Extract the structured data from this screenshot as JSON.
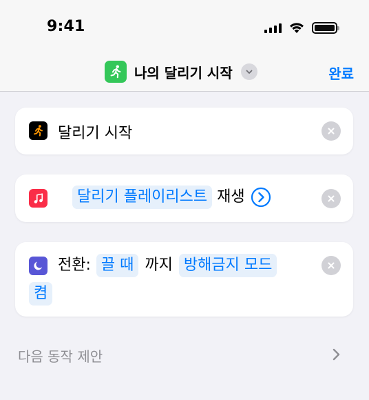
{
  "status_bar": {
    "time": "9:41"
  },
  "nav": {
    "title": "나의 달리기 시작",
    "done_label": "완료",
    "app_icon": "runner-icon",
    "app_icon_color": "#34C759"
  },
  "actions": [
    {
      "icon": "runner-icon",
      "icon_bg": "#000000",
      "icon_fg": "#FF9500",
      "title": "달리기 시작"
    },
    {
      "icon": "music-note-icon",
      "icon_bg": "#FA2D48",
      "playlist_token": "달리기 플레이리스트",
      "verb": "재생"
    },
    {
      "icon": "moon-icon",
      "icon_bg": "#5856D6",
      "label": "전환:",
      "duration_token": "끌 때",
      "until_text": "까지",
      "focus_token": "방해금지 모드",
      "state_token": "켬"
    }
  ],
  "next_action_suggestion": "다음 동작 제안",
  "colors": {
    "accent": "#007AFF",
    "token_bg": "#E6F0FB",
    "background": "#F2F2F7"
  }
}
